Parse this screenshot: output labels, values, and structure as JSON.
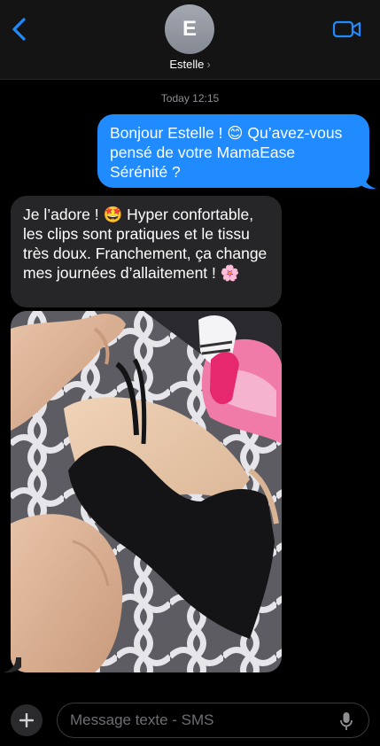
{
  "header": {
    "avatar_initial": "E",
    "contact_name": "Estelle",
    "chevron": "›",
    "icons": {
      "back": "chevron-left-icon",
      "video": "video-camera-icon"
    }
  },
  "conversation": {
    "timestamp": "Today 12:15",
    "messages": [
      {
        "direction": "sent",
        "text": "Bonjour Estelle ! 😊 Qu’avez-vous pensé de votre MamaEase Sérénité ?"
      },
      {
        "direction": "received",
        "text": "Je l’adore ! 🤩 Hyper confortable, les clips sont pratiques et le tissu très doux. Franchement, ça change mes journées d’allaitement ! 🌸"
      },
      {
        "direction": "received",
        "type": "photo",
        "description_icon": "photo-attachment"
      }
    ]
  },
  "composer": {
    "placeholder": "Message texte - SMS",
    "value": "",
    "icons": {
      "add": "plus-icon",
      "mic": "microphone-icon"
    }
  },
  "colors": {
    "sent_bubble": "#1f8bff",
    "received_bubble": "#262628",
    "accent": "#1f8bff",
    "background": "#000000"
  }
}
